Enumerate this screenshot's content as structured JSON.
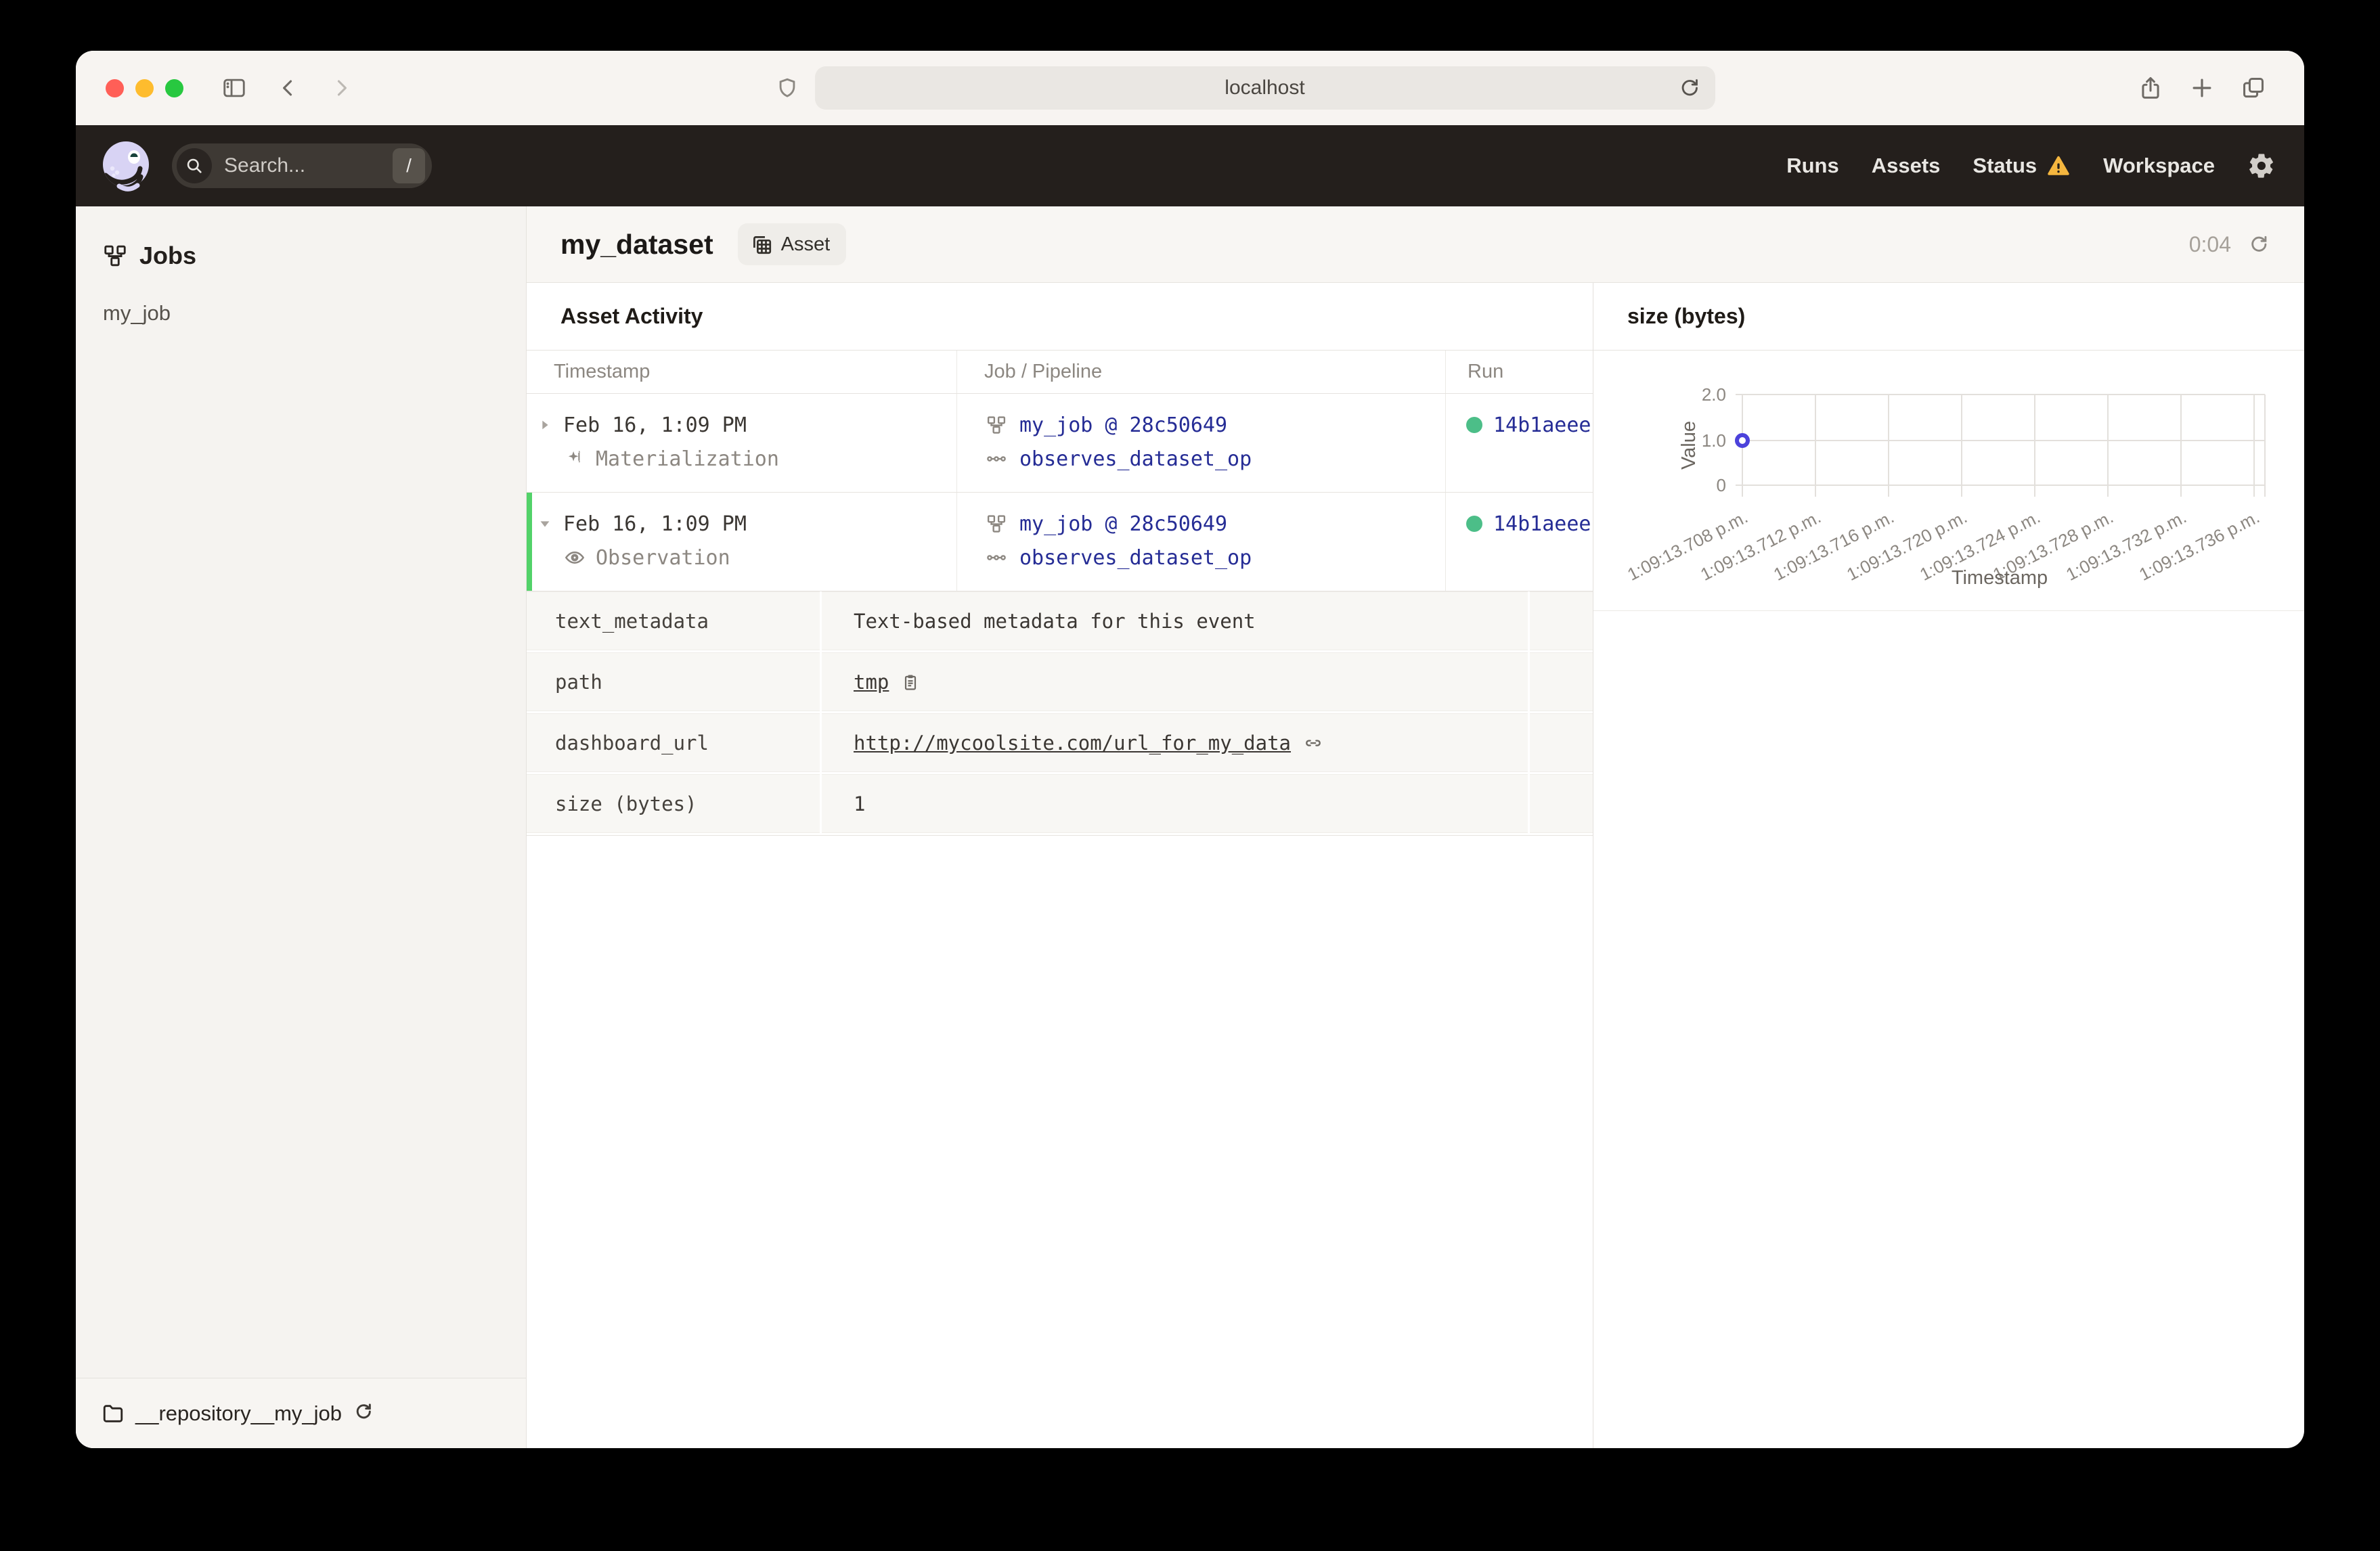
{
  "browser": {
    "url": "localhost"
  },
  "header": {
    "search": {
      "placeholder": "Search...",
      "shortcut": "/"
    },
    "nav": {
      "runs": "Runs",
      "assets": "Assets",
      "status": "Status",
      "workspace": "Workspace"
    }
  },
  "sidebar": {
    "title": "Jobs",
    "items": [
      {
        "label": "my_job"
      }
    ],
    "footer": {
      "repository": "__repository__my_job"
    }
  },
  "page": {
    "title": "my_dataset",
    "badge": "Asset",
    "timer": "0:04"
  },
  "activity": {
    "section_title": "Asset Activity",
    "columns": [
      "Timestamp",
      "Job / Pipeline",
      "Run"
    ],
    "rows": [
      {
        "timestamp": "Feb 16, 1:09 PM",
        "event_type": "Materialization",
        "job": "my_job @ 28c50649",
        "op": "observes_dataset_op",
        "run_id": "14b1aeee"
      },
      {
        "timestamp": "Feb 16, 1:09 PM",
        "event_type": "Observation",
        "job": "my_job @ 28c50649",
        "op": "observes_dataset_op",
        "run_id": "14b1aeee"
      }
    ],
    "metadata": [
      {
        "key": "text_metadata",
        "value": "Text-based metadata for this event"
      },
      {
        "key": "path",
        "value": "tmp"
      },
      {
        "key": "dashboard_url",
        "value": "http://mycoolsite.com/url_for_my_data"
      },
      {
        "key": "size (bytes)",
        "value": "1"
      }
    ]
  },
  "chart_data": {
    "type": "scatter",
    "title": "size (bytes)",
    "xlabel": "Timestamp",
    "ylabel": "Value",
    "ylim": [
      0,
      2
    ],
    "y_ticks": [
      "2.0",
      "1.0",
      "0"
    ],
    "grid": true,
    "x_labels": [
      "1:09:13.708 p.m.",
      "1:09:13.712 p.m.",
      "1:09:13.716 p.m.",
      "1:09:13.720 p.m.",
      "1:09:13.724 p.m.",
      "1:09:13.728 p.m.",
      "1:09:13.732 p.m.",
      "1:09:13.736 p.m."
    ],
    "points": [
      {
        "x": "1:09:13.708 p.m.",
        "y": 1.0
      }
    ]
  },
  "colors": {
    "accent_green": "#4CBE88",
    "expanded_row_green": "#52D269",
    "link_navy": "#252C95",
    "point_indigo": "#4C42DB",
    "warning_amber": "#F5B63F"
  }
}
